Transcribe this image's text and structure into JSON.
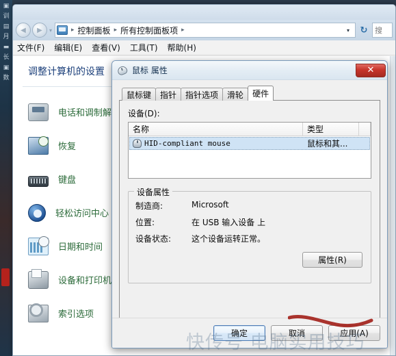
{
  "window": {
    "nav": {
      "back_label": "◀",
      "forward_label": "▶",
      "history_caret": "▾"
    },
    "address": {
      "icon": "control-panel-icon",
      "crumbs": [
        "控制面板",
        "所有控制面板项"
      ],
      "separator": "▸",
      "trailing_separator": "▸",
      "dropdown_caret": "▾",
      "refresh_label": "↻"
    },
    "search": {
      "value": "",
      "placeholder": "搜"
    },
    "menubar": [
      "文件(F)",
      "编辑(E)",
      "查看(V)",
      "工具(T)",
      "帮助(H)"
    ]
  },
  "control_panel": {
    "heading": "调整计算机的设置",
    "items": [
      {
        "label": "电话和调制解调器",
        "icon": "modem-icon"
      },
      {
        "label": "恢复",
        "icon": "recovery-icon"
      },
      {
        "label": "键盘",
        "icon": "keyboard-icon"
      },
      {
        "label": "轻松访问中心",
        "icon": "ease-of-access-icon"
      },
      {
        "label": "日期和时间",
        "icon": "date-time-icon"
      },
      {
        "label": "设备和打印机",
        "icon": "devices-printers-icon"
      },
      {
        "label": "索引选项",
        "icon": "indexing-options-icon"
      }
    ]
  },
  "dialog": {
    "title": "鼠标 属性",
    "title_icon": "mouse-icon",
    "close_label": "✕",
    "tabs": [
      {
        "label": "鼠标键",
        "active": false
      },
      {
        "label": "指针",
        "active": false
      },
      {
        "label": "指针选项",
        "active": false
      },
      {
        "label": "滑轮",
        "active": false
      },
      {
        "label": "硬件",
        "active": true
      }
    ],
    "devices_label": "设备(D):",
    "columns": [
      "名称",
      "类型"
    ],
    "rows": [
      {
        "name": "HID-compliant mouse",
        "type": "鼠标和其...",
        "icon": "mouse-device-icon",
        "selected": true
      }
    ],
    "properties": {
      "legend": "设备属性",
      "fields": [
        {
          "key": "制造商:",
          "value": "Microsoft"
        },
        {
          "key": "位置:",
          "value": "在 USB 输入设备 上"
        },
        {
          "key": "设备状态:",
          "value": "这个设备运转正常。"
        }
      ]
    },
    "properties_button": "属性(R)",
    "footer_buttons": [
      {
        "label": "确定",
        "default": true
      },
      {
        "label": "取消",
        "default": false
      },
      {
        "label": "应用(A)",
        "default": false
      }
    ]
  },
  "annotation": {
    "color": "#a3231c",
    "kind": "red-underline-stroke"
  },
  "watermark": {
    "text": "快传号 电脑实用技巧"
  },
  "colors": {
    "accent": "#1b3f7a",
    "link_green": "#2c6b3a",
    "selection": "#cfe3f5",
    "close_red": "#c7352c"
  }
}
